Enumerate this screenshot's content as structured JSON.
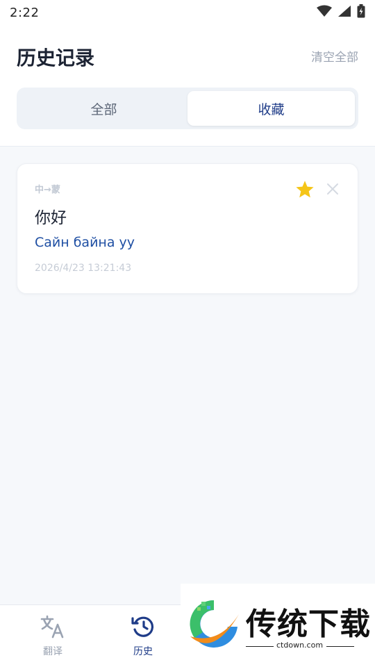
{
  "status_bar": {
    "time": "2:22"
  },
  "header": {
    "title": "历史记录",
    "clear_all": "清空全部",
    "tabs": [
      {
        "label": "全部",
        "active": false
      },
      {
        "label": "收藏",
        "active": true
      }
    ]
  },
  "history": {
    "items": [
      {
        "lang_pair": "中→蒙",
        "source": "你好",
        "target": "Сайн байна уу",
        "time": "2026/4/23 13:21:43",
        "starred": true
      }
    ]
  },
  "bottom_nav": {
    "items": [
      {
        "label": "翻译",
        "icon": "translate-icon",
        "active": false
      },
      {
        "label": "历史",
        "icon": "history-icon",
        "active": true
      }
    ]
  },
  "watermark": {
    "text": "传统下载",
    "url": "ctdown.com"
  },
  "colors": {
    "accent": "#1f3c88",
    "star": "#f5c518",
    "target_text": "#1f4fa3",
    "background": "#f6f8fb"
  }
}
